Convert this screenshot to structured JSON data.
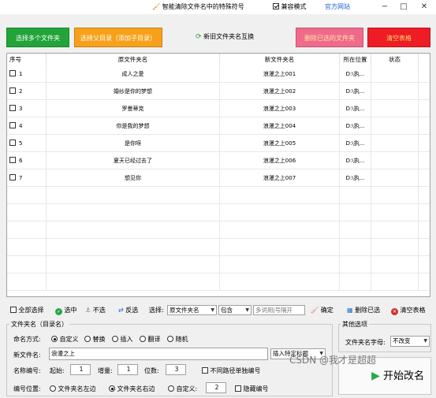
{
  "titlebar": {
    "special_chars_label": "智能清除文件名中的特殊符号",
    "compat_mode_label": "兼容模式",
    "official_site_label": "官方网站",
    "minimize": "−",
    "restore": "□",
    "close": "✕"
  },
  "toolbar": {
    "select_multiple_label": "选择多个文件夹",
    "select_parent_label": "选择父目录（添加子目录）",
    "swap_label": "新旧文件夹名互换",
    "delete_selected_label": "删除已选的文件夹",
    "clear_table_label": "清空表格"
  },
  "table": {
    "headers": [
      "序号",
      "原文件夹名",
      "新文件夹名",
      "所在位置",
      "状态"
    ],
    "rows": [
      {
        "index": "1",
        "old": "成人之愛",
        "new": "浪漫之上001",
        "loc": "D:\\执...",
        "status": ""
      },
      {
        "index": "2",
        "old": "婚纱是你的梦想",
        "new": "浪漫之上002",
        "loc": "D:\\执...",
        "status": ""
      },
      {
        "index": "3",
        "old": "罗曼蒂克",
        "new": "浪漫之上003",
        "loc": "D:\\执...",
        "status": ""
      },
      {
        "index": "4",
        "old": "你是我的梦想",
        "new": "浪漫之上004",
        "loc": "D:\\执...",
        "status": ""
      },
      {
        "index": "5",
        "old": "是你呀",
        "new": "浪漫之上005",
        "loc": "D:\\执...",
        "status": ""
      },
      {
        "index": "6",
        "old": "夏天已经过去了",
        "new": "浪漫之上006",
        "loc": "D:\\执...",
        "status": ""
      },
      {
        "index": "7",
        "old": "想见你",
        "new": "浪漫之上007",
        "loc": "D:\\执...",
        "status": ""
      }
    ]
  },
  "bottombar": {
    "select_all": "全部选择",
    "select": "选中",
    "deselect": "不选",
    "invert": "反选",
    "select_label": "选择:",
    "column_select": "原文件夹名",
    "match_select": "包含",
    "keyword_placeholder": "多词用|号隔开",
    "confirm": "确定",
    "delete_selected": "删除已选",
    "clear_table": "清空表格"
  },
  "naming": {
    "group_title": "文件夹名（目录名）",
    "mode_label": "命名方式:",
    "modes": [
      "自定义",
      "替换",
      "插入",
      "翻译",
      "随机"
    ],
    "new_name_label": "新文件名:",
    "new_name_value": "浪漫之上",
    "insert_title_select": "插入特定标题",
    "numbering_label": "名称编号:",
    "start_label": "起始:",
    "start_value": "1",
    "increment_label": "增量:",
    "increment_value": "1",
    "digits_label": "位数:",
    "digits_value": "3",
    "separate_path_label": "不同路径单独编号",
    "position_label": "编号位置:",
    "positions": [
      "文件夹名左边",
      "文件夹名右边",
      "自定义:"
    ],
    "custom_pos_value": "2",
    "hide_number_label": "隐藏编号"
  },
  "other": {
    "group_title": "其他选项",
    "case_label": "文件夹名字母:",
    "case_value": "不改变",
    "start_button_label": "开始改名"
  },
  "watermark": "CSDN @我才是超超",
  "colors": {
    "green": "#22a43a",
    "orange": "#f7a11b",
    "pink": "#f06a8c",
    "red": "#ee1c25"
  }
}
